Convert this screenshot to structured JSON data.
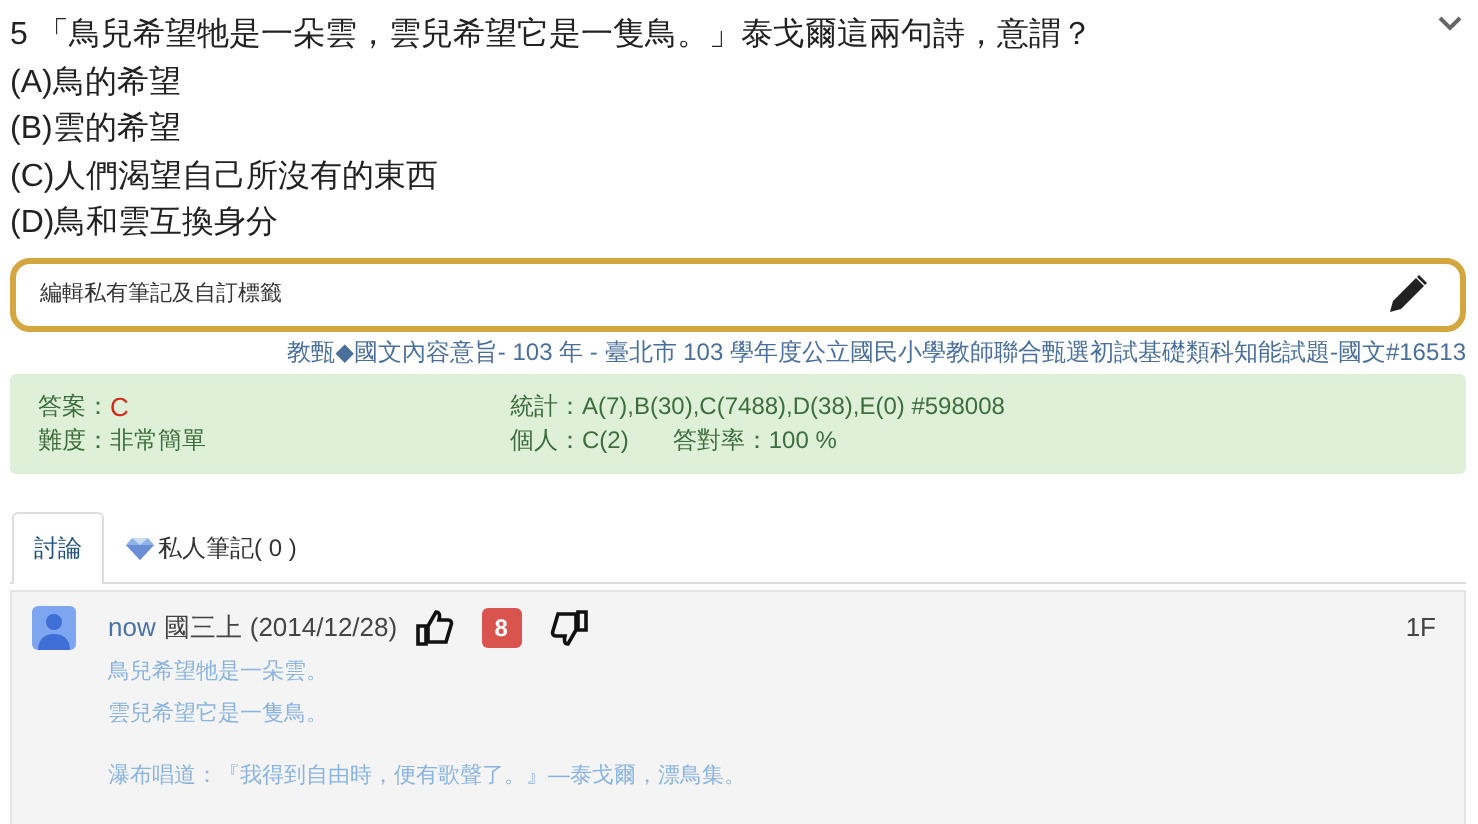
{
  "question": {
    "number": "5",
    "text": "「鳥兒希望牠是一朵雲，雲兒希望它是一隻鳥。」泰戈爾這兩句詩，意謂？",
    "options": [
      "(A)鳥的希望",
      "(B)雲的希望",
      "(C)人們渴望自己所沒有的東西",
      "(D)鳥和雲互換身分"
    ]
  },
  "note_field": {
    "placeholder": "編輯私有筆記及自訂標籤"
  },
  "source": "教甄◆國文內容意旨- 103 年 - 臺北市 103 學年度公立國民小學教師聯合甄選初試基礎類科知能試題-國文#16513",
  "stats": {
    "answer_label": "答案：",
    "answer": "C",
    "difficulty": "難度：非常簡單",
    "stats_label": "統計：",
    "stats": "A(7),B(30),C(7488),D(38),E(0) #598008",
    "personal_label": "個人：",
    "personal": "C(2)",
    "rate": "答對率：100 %"
  },
  "tabs": [
    {
      "label": "討論",
      "selected": true,
      "kind": "plain"
    },
    {
      "label": "私人筆記( 0 )",
      "selected": false,
      "kind": "gem"
    }
  ],
  "comments": [
    {
      "user": "now",
      "grade": "國三上",
      "date": "(2014/12/28)",
      "likes": "8",
      "floor": "1F",
      "paragraphs": [
        [
          "鳥兒希望牠是一朵雲。",
          "雲兒希望它是一隻鳥。"
        ],
        [
          "瀑布唱道：『我得到自由時，便有歌聲了。』—泰戈爾，漂鳥集。"
        ]
      ]
    }
  ]
}
